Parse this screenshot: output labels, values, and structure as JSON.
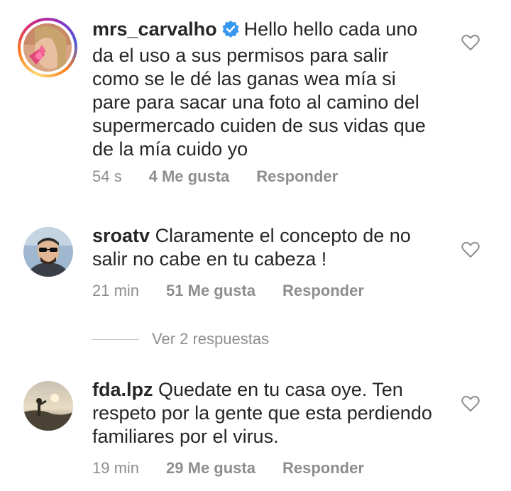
{
  "comments": [
    {
      "username": "mrs_carvalho",
      "verified": true,
      "lines": [
        "Hello hello cada uno",
        "da el uso a sus permisos para salir",
        "como se le dé las ganas wea mía si",
        "pare para sacar una foto al camino del",
        "supermercado cuiden de sus vidas que",
        "de la mía cuido yo"
      ],
      "time": "54 s",
      "likes": "4 Me gusta",
      "reply": "Responder"
    },
    {
      "username": "sroatv",
      "verified": false,
      "lines": [
        "Claramente el concepto de no",
        "salir no cabe en tu cabeza !"
      ],
      "time": "21 min",
      "likes": "51 Me gusta",
      "reply": "Responder",
      "view_replies": "Ver 2 respuestas"
    },
    {
      "username": "fda.lpz",
      "verified": false,
      "lines": [
        "Quedate en tu casa oye. Ten",
        "respeto por la gente que esta perdiendo",
        "familiares por el virus."
      ],
      "time": "19 min",
      "likes": "29 Me gusta",
      "reply": "Responder"
    }
  ],
  "icons": {
    "like": "heart-outline-icon",
    "verified": "verified-badge-icon"
  },
  "colors": {
    "verified_blue": "#3897f0",
    "secondary_text": "#8e8e8e",
    "primary_text": "#262626"
  }
}
